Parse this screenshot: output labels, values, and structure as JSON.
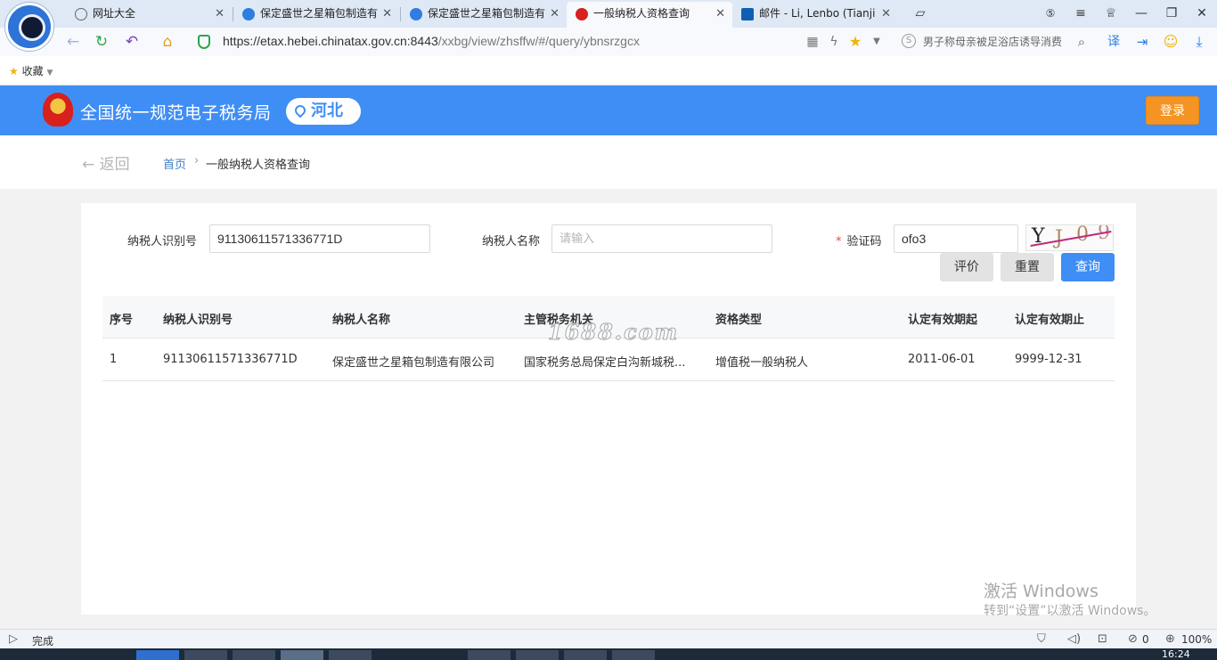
{
  "browser": {
    "tabs": [
      {
        "title": "网址大全"
      },
      {
        "title": "保定盛世之星箱包制造有"
      },
      {
        "title": "保定盛世之星箱包制造有"
      },
      {
        "title": "一般纳税人资格查询"
      },
      {
        "title": "邮件 - Li, Lenbo (Tianji"
      }
    ],
    "url_host": "https://etax.hebei.chinatax.gov.cn:8443",
    "url_path": "/xxbg/view/zhsffw/#/query/ybnsrzgcx",
    "search_text": "男子称母亲被足浴店诱导消费",
    "bookmark_label": "收藏",
    "status_text": "完成",
    "status_count": "0",
    "zoom": "100%",
    "clock": "16:24"
  },
  "site": {
    "title": "全国统一规范电子税务局",
    "region": "河北",
    "login_label": "登录",
    "back_label": "返回",
    "breadcrumb_home": "首页",
    "breadcrumb_sep": "›",
    "breadcrumb_current": "一般纳税人资格查询"
  },
  "form": {
    "taxpayer_id_label": "纳税人识别号",
    "taxpayer_id_value": "91130611571336771D",
    "taxpayer_name_label": "纳税人名称",
    "taxpayer_name_placeholder": "请输入",
    "captcha_label": "验证码",
    "captcha_required": "*",
    "captcha_value": "ofo3",
    "captcha_chars": [
      "Y",
      "J",
      "0",
      "9"
    ],
    "buttons": {
      "rate": "评价",
      "reset": "重置",
      "query": "查询"
    }
  },
  "table": {
    "headers": [
      "序号",
      "纳税人识别号",
      "纳税人名称",
      "主管税务机关",
      "资格类型",
      "认定有效期起",
      "认定有效期止"
    ],
    "rows": [
      [
        "1",
        "91130611571336771D",
        "保定盛世之星箱包制造有限公司",
        "国家税务总局保定白沟新城税...",
        "增值税一般纳税人",
        "2011-06-01",
        "9999-12-31"
      ]
    ]
  },
  "overlay": {
    "watermark": "1688.com",
    "activation_title": "激活 Windows",
    "activation_hint": "转到“设置”以激活 Windows。"
  }
}
